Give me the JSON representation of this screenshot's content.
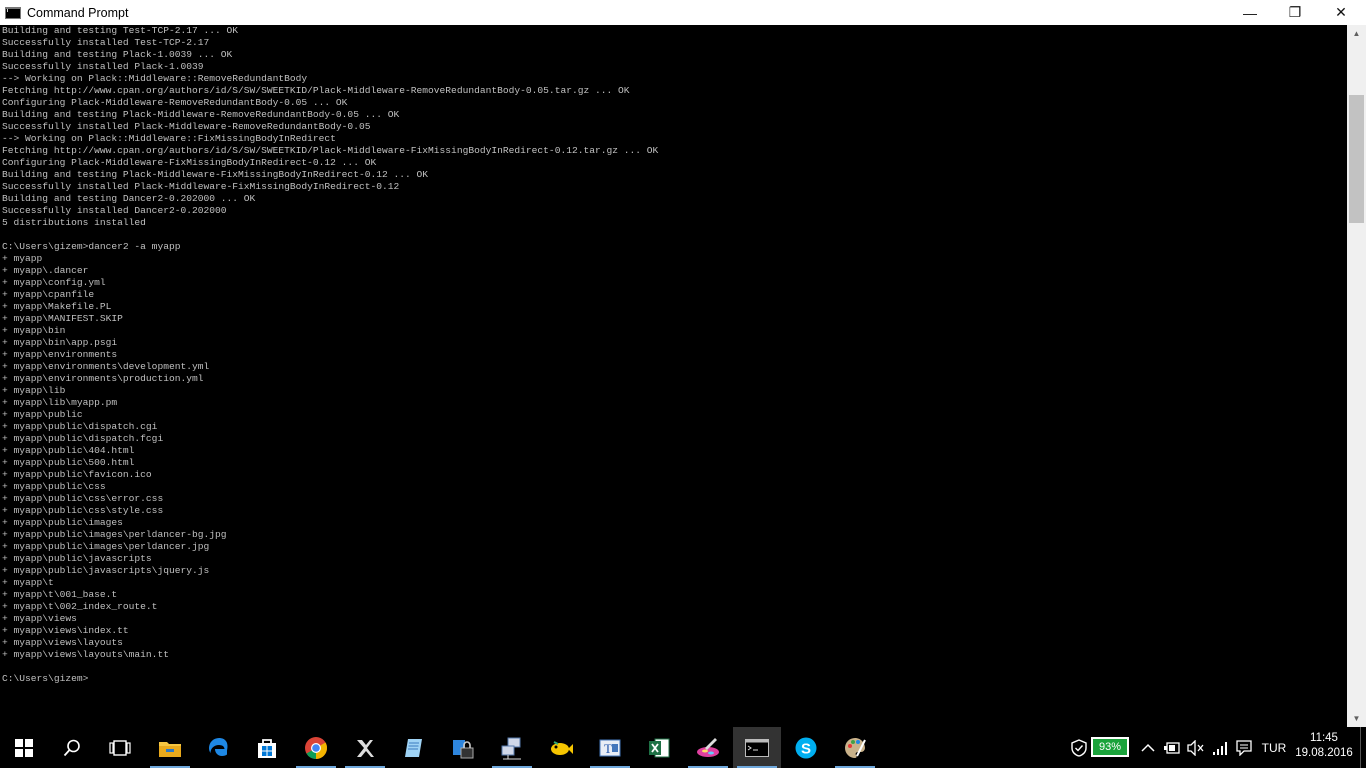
{
  "window": {
    "title": "Command Prompt",
    "minimize_glyph": "—",
    "maximize_glyph": "❐",
    "close_glyph": "✕"
  },
  "console": {
    "lines": [
      "Building and testing Test-TCP-2.17 ... OK",
      "Successfully installed Test-TCP-2.17",
      "Building and testing Plack-1.0039 ... OK",
      "Successfully installed Plack-1.0039",
      "--> Working on Plack::Middleware::RemoveRedundantBody",
      "Fetching http://www.cpan.org/authors/id/S/SW/SWEETKID/Plack-Middleware-RemoveRedundantBody-0.05.tar.gz ... OK",
      "Configuring Plack-Middleware-RemoveRedundantBody-0.05 ... OK",
      "Building and testing Plack-Middleware-RemoveRedundantBody-0.05 ... OK",
      "Successfully installed Plack-Middleware-RemoveRedundantBody-0.05",
      "--> Working on Plack::Middleware::FixMissingBodyInRedirect",
      "Fetching http://www.cpan.org/authors/id/S/SW/SWEETKID/Plack-Middleware-FixMissingBodyInRedirect-0.12.tar.gz ... OK",
      "Configuring Plack-Middleware-FixMissingBodyInRedirect-0.12 ... OK",
      "Building and testing Plack-Middleware-FixMissingBodyInRedirect-0.12 ... OK",
      "Successfully installed Plack-Middleware-FixMissingBodyInRedirect-0.12",
      "Building and testing Dancer2-0.202000 ... OK",
      "Successfully installed Dancer2-0.202000",
      "5 distributions installed",
      "",
      "C:\\Users\\gizem>dancer2 -a myapp",
      "+ myapp",
      "+ myapp\\.dancer",
      "+ myapp\\config.yml",
      "+ myapp\\cpanfile",
      "+ myapp\\Makefile.PL",
      "+ myapp\\MANIFEST.SKIP",
      "+ myapp\\bin",
      "+ myapp\\bin\\app.psgi",
      "+ myapp\\environments",
      "+ myapp\\environments\\development.yml",
      "+ myapp\\environments\\production.yml",
      "+ myapp\\lib",
      "+ myapp\\lib\\myapp.pm",
      "+ myapp\\public",
      "+ myapp\\public\\dispatch.cgi",
      "+ myapp\\public\\dispatch.fcgi",
      "+ myapp\\public\\404.html",
      "+ myapp\\public\\500.html",
      "+ myapp\\public\\favicon.ico",
      "+ myapp\\public\\css",
      "+ myapp\\public\\css\\error.css",
      "+ myapp\\public\\css\\style.css",
      "+ myapp\\public\\images",
      "+ myapp\\public\\images\\perldancer-bg.jpg",
      "+ myapp\\public\\images\\perldancer.jpg",
      "+ myapp\\public\\javascripts",
      "+ myapp\\public\\javascripts\\jquery.js",
      "+ myapp\\t",
      "+ myapp\\t\\001_base.t",
      "+ myapp\\t\\002_index_route.t",
      "+ myapp\\views",
      "+ myapp\\views\\index.tt",
      "+ myapp\\views\\layouts",
      "+ myapp\\views\\layouts\\main.tt",
      "",
      "C:\\Users\\gizem>"
    ]
  },
  "taskbar": {
    "pinned": [
      {
        "name": "start-button",
        "icon": "windows-logo-icon"
      },
      {
        "name": "search-button",
        "icon": "search-icon"
      },
      {
        "name": "task-view-button",
        "icon": "task-view-icon"
      },
      {
        "name": "file-explorer",
        "icon": "folder-icon"
      },
      {
        "name": "edge",
        "icon": "edge-icon"
      },
      {
        "name": "store",
        "icon": "store-icon"
      },
      {
        "name": "chrome",
        "icon": "chrome-icon"
      },
      {
        "name": "xampp",
        "icon": "xampp-icon"
      },
      {
        "name": "notepad",
        "icon": "notepad-icon"
      },
      {
        "name": "security-app",
        "icon": "lock-icon"
      },
      {
        "name": "network-app",
        "icon": "network-computer-icon"
      },
      {
        "name": "game-app",
        "icon": "fish-icon"
      },
      {
        "name": "typing-app",
        "icon": "typing-icon"
      },
      {
        "name": "excel",
        "icon": "excel-icon"
      },
      {
        "name": "paint",
        "icon": "paint-icon"
      },
      {
        "name": "command-prompt",
        "icon": "cmd-icon"
      },
      {
        "name": "skype",
        "icon": "skype-icon"
      },
      {
        "name": "paint-palette",
        "icon": "palette-icon"
      }
    ],
    "battery_percent": "93%",
    "language": "TUR",
    "time": "11:45",
    "date": "19.08.2016",
    "colors": {
      "accent_underline": "#6fa8dc",
      "battery_green": "#1aa33b"
    }
  }
}
